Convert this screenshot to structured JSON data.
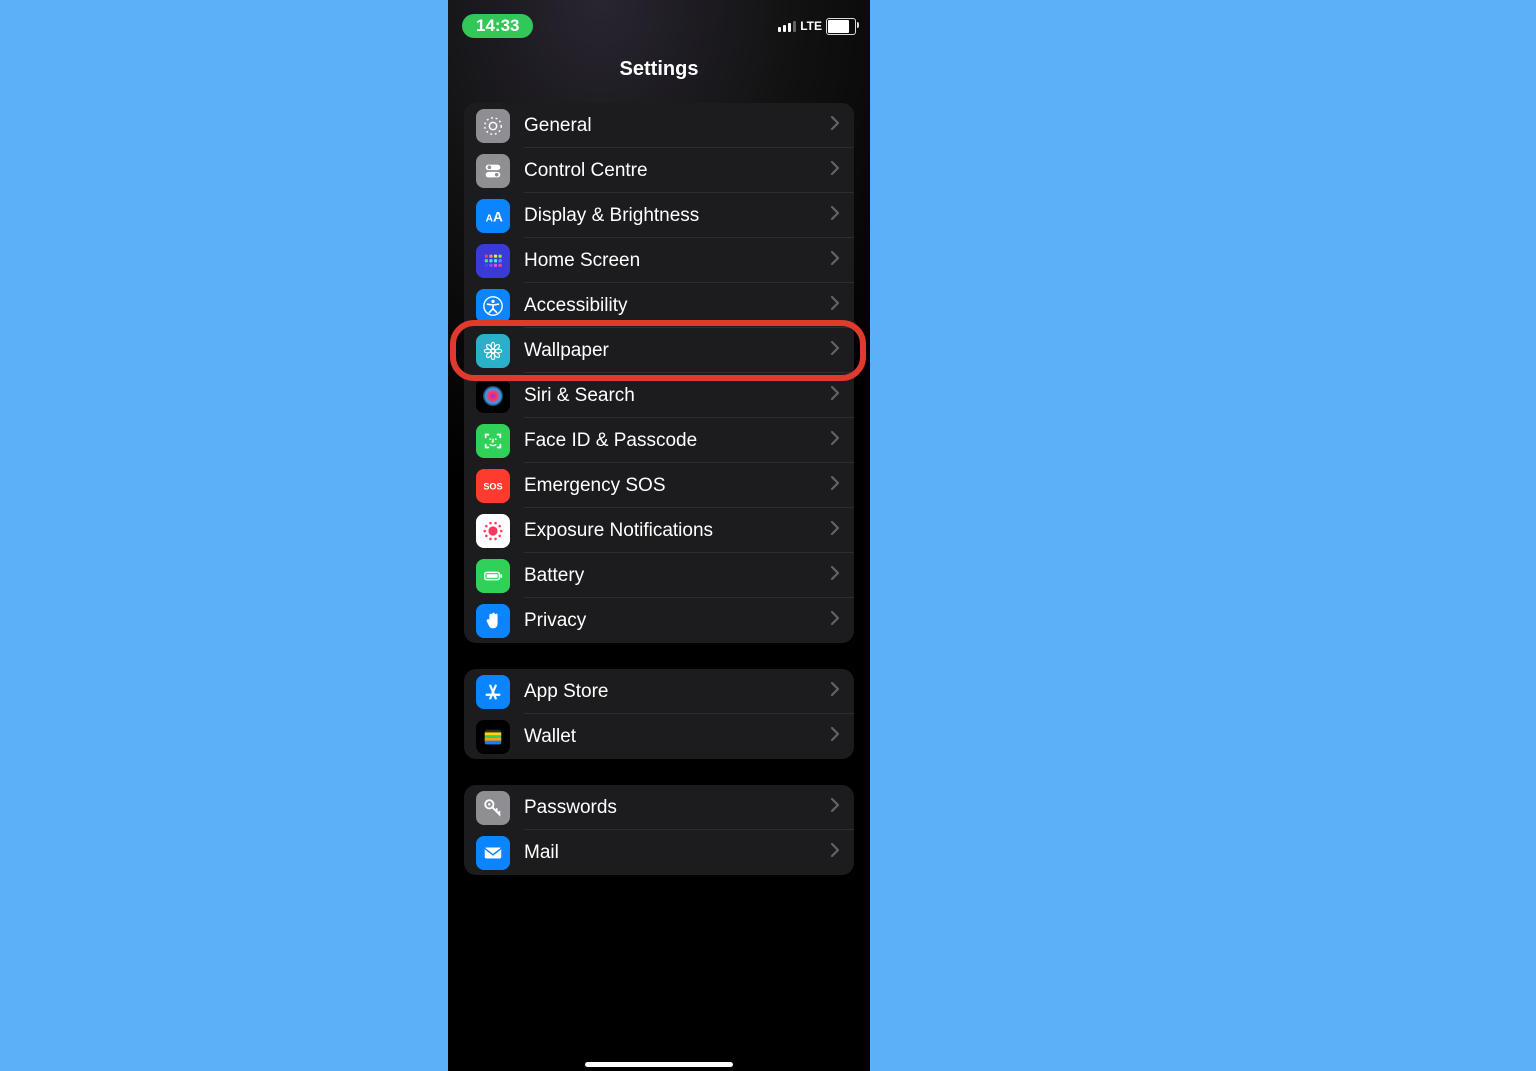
{
  "status": {
    "time": "14:33",
    "network": "LTE"
  },
  "title": "Settings",
  "groups": [
    {
      "rows": [
        {
          "id": "general",
          "label": "General",
          "icon": "gear",
          "bg": "#8e8e93"
        },
        {
          "id": "control-centre",
          "label": "Control Centre",
          "icon": "toggles",
          "bg": "#8e8e93"
        },
        {
          "id": "display",
          "label": "Display & Brightness",
          "icon": "text",
          "bg": "#0a84ff"
        },
        {
          "id": "home-screen",
          "label": "Home Screen",
          "icon": "grid",
          "bg": "#3a3ad6"
        },
        {
          "id": "accessibility",
          "label": "Accessibility",
          "icon": "access",
          "bg": "#0a84ff"
        },
        {
          "id": "wallpaper",
          "label": "Wallpaper",
          "icon": "flower",
          "bg": "#2bb0c9",
          "highlight": true
        },
        {
          "id": "siri",
          "label": "Siri & Search",
          "icon": "siri",
          "bg": "#000"
        },
        {
          "id": "faceid",
          "label": "Face ID & Passcode",
          "icon": "face",
          "bg": "#30d158"
        },
        {
          "id": "sos",
          "label": "Emergency SOS",
          "icon": "sos",
          "bg": "#ff3b30"
        },
        {
          "id": "exposure",
          "label": "Exposure Notifications",
          "icon": "exposure",
          "bg": "#fff"
        },
        {
          "id": "battery",
          "label": "Battery",
          "icon": "battery",
          "bg": "#30d158"
        },
        {
          "id": "privacy",
          "label": "Privacy",
          "icon": "hand",
          "bg": "#0a84ff"
        }
      ]
    },
    {
      "rows": [
        {
          "id": "appstore",
          "label": "App Store",
          "icon": "appstore",
          "bg": "#0a84ff"
        },
        {
          "id": "wallet",
          "label": "Wallet",
          "icon": "wallet",
          "bg": "#000"
        }
      ]
    },
    {
      "rows": [
        {
          "id": "passwords",
          "label": "Passwords",
          "icon": "key",
          "bg": "#8e8e93"
        },
        {
          "id": "mail",
          "label": "Mail",
          "icon": "mail",
          "bg": "#0a84ff"
        }
      ]
    }
  ]
}
